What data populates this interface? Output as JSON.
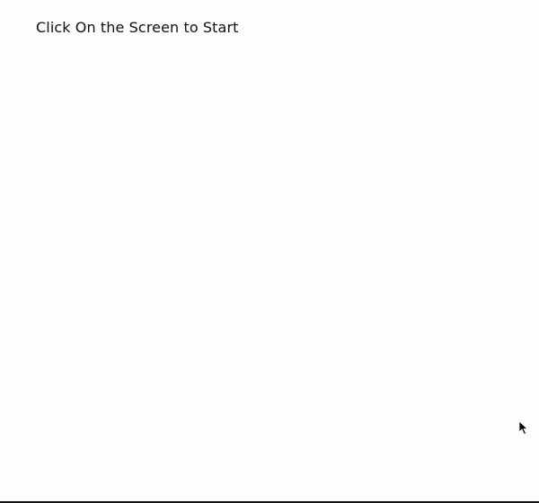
{
  "prompt": {
    "text": "Click On the Screen to Start"
  },
  "cursor": {
    "icon": "arrow-pointer-icon"
  },
  "colors": {
    "background": "#fdfcfe",
    "text": "#111111"
  }
}
